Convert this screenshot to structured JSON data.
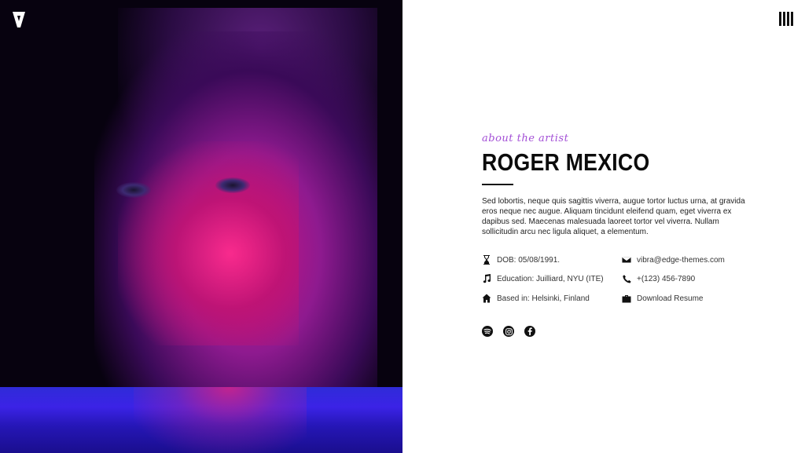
{
  "hero": {
    "image_alt": "Portrait of the artist lit in pink and purple neon light above blue water"
  },
  "branding": {
    "logo_letter": "V"
  },
  "about": {
    "kicker": "about the artist",
    "name": "ROGER MEXICO",
    "bio": "Sed lobortis, neque quis sagittis viverra, augue tortor luctus urna, at gravida eros neque nec augue. Aliquam tincidunt eleifend quam, eget viverra ex dapibus sed. Maecenas malesuada laoreet tortor vel viverra. Nullam sollicitudin arcu nec ligula aliquet, a elementum."
  },
  "details": {
    "dob": "DOB: 05/08/1991.",
    "education": "Education: Juilliard, NYU (ITE)",
    "based": "Based in: Helsinki, Finland",
    "email": "vibra@edge-themes.com",
    "phone": "+(123) 456-7890",
    "resume": "Download Resume"
  },
  "icons": {
    "dob": "hourglass-icon",
    "education": "music-note-icon",
    "based": "home-icon",
    "email": "envelope-icon",
    "phone": "phone-icon",
    "resume": "briefcase-icon",
    "social": [
      "spotify-icon",
      "instagram-icon",
      "facebook-icon"
    ],
    "menu": "menu-bars-icon"
  },
  "colors": {
    "accent": "#a34fd6",
    "text": "#111111",
    "background": "#ffffff"
  }
}
